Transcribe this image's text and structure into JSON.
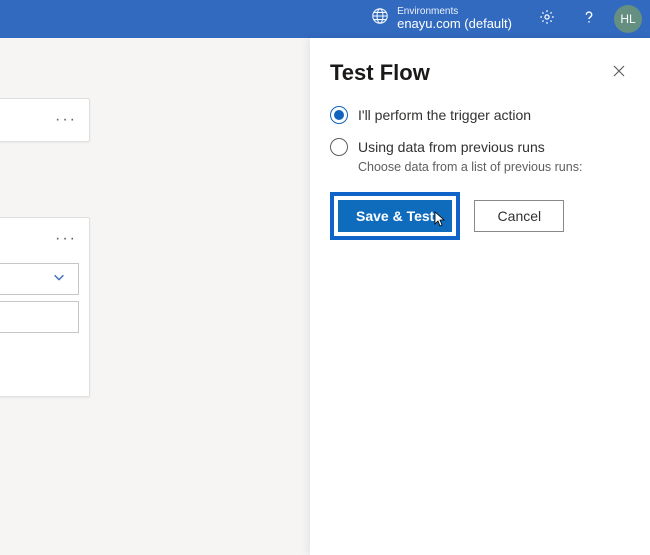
{
  "header": {
    "env_label": "Environments",
    "env_name": "enayu.com (default)",
    "avatar_initials": "HL"
  },
  "panel": {
    "title": "Test Flow",
    "option1_label": "I'll perform the trigger action",
    "option2_label": "Using data from previous runs",
    "option2_desc": "Choose data from a list of previous runs:",
    "save_label": "Save & Test",
    "cancel_label": "Cancel"
  }
}
